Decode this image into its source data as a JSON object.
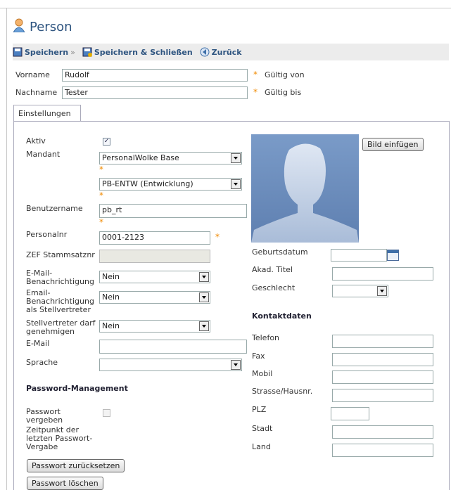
{
  "title": "Person",
  "toolbar": {
    "save": "Speichern",
    "save_close": "Speichern & Schließen",
    "back": "Zurück"
  },
  "header": {
    "first_name_label": "Vorname",
    "first_name_value": "Rudolf",
    "last_name_label": "Nachname",
    "last_name_value": "Tester",
    "valid_from_label": "Gültig von",
    "valid_to_label": "Gültig bis"
  },
  "tab": "Einstellungen",
  "left": {
    "active_label": "Aktiv",
    "client_label": "Mandant",
    "client_value": "PersonalWolke Base",
    "org_value": "PB-ENTW (Entwicklung)",
    "username_label": "Benutzername",
    "username_value": "pb_rt",
    "staff_no_label": "Personalnr",
    "staff_no_value": "0001-2123",
    "zef_label": "ZEF Stammsatznr",
    "email_notify_label": "E-Mail-Benachrichtigung",
    "email_notify_value": "Nein",
    "email_deputy_label": "Email-Benachrichtigung als Stellvertreter",
    "email_deputy_value": "Nein",
    "deputy_approve_label": "Stellvertreter darf genehmigen",
    "deputy_approve_value": "Nein",
    "email_label": "E-Mail",
    "language_label": "Sprache",
    "password_section": "Password-Management",
    "password_assign_label": "Passwort vergeben",
    "password_time_label": "Zeitpunkt der letzten Passwort-Vergabe",
    "reset_button": "Passwort zurücksetzen",
    "delete_button": "Passwort löschen"
  },
  "right": {
    "insert_image_button": "Bild einfügen",
    "birthdate_label": "Geburtsdatum",
    "academic_title_label": "Akad. Titel",
    "gender_label": "Geschlecht",
    "contact_section": "Kontaktdaten",
    "phone_label": "Telefon",
    "fax_label": "Fax",
    "mobile_label": "Mobil",
    "street_label": "Strasse/Hausnr.",
    "zip_label": "PLZ",
    "city_label": "Stadt",
    "country_label": "Land"
  },
  "colors": {
    "accent": "#2f5580",
    "required": "#f08a00",
    "toolbar_bg": "#ececec"
  }
}
